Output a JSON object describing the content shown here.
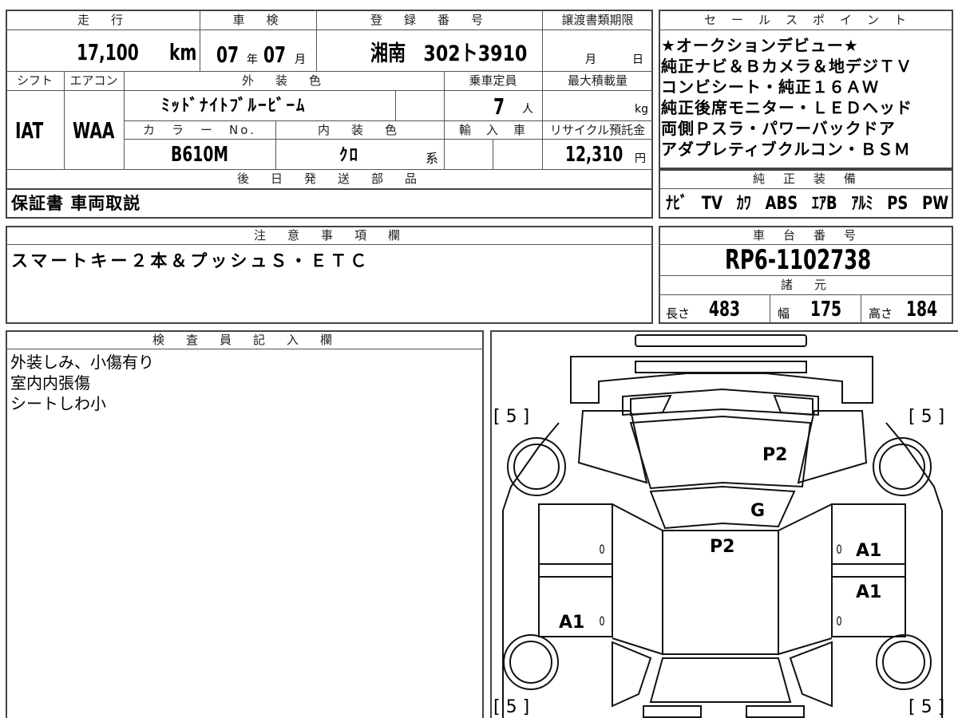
{
  "top_table": {
    "mileage_header": "走　行",
    "mileage_value": "17,100",
    "mileage_unit": "km",
    "inspection_header": "車　検",
    "inspection_year": "07",
    "inspection_year_unit": "年",
    "inspection_month": "07",
    "inspection_month_unit": "月",
    "registration_header": "登　録　番　号",
    "registration_value": "湘南　302ト3910",
    "transfer_header": "譲渡書類期限",
    "transfer_month_unit": "月",
    "transfer_day_unit": "日",
    "shift_header": "シフト",
    "shift_value": "IAT",
    "aircon_header": "エアコン",
    "aircon_value": "WAA",
    "exterior_header": "外　装　色",
    "exterior_value": "ﾐｯﾄﾞﾅｲﾄﾌﾞﾙｰﾋﾞｰﾑ",
    "capacity_header": "乗車定員",
    "capacity_value": "7",
    "capacity_unit": "人",
    "max_load_header": "最大積載量",
    "max_load_unit": "kg",
    "color_no_header": "カ　ラ　ー　No.",
    "color_no_value": "B610M",
    "interior_header": "内　装　色",
    "interior_value": "ｸﾛ",
    "interior_suffix": "系",
    "import_header": "輸　入　車",
    "recycle_header": "リサイクル預託金",
    "recycle_value": "12,310",
    "recycle_unit": "円",
    "parts_header": "後　日　発　送　部　品",
    "parts_value": "保証書 車両取説"
  },
  "sales_points": {
    "header": "セ　ー　ル　ス　ポ　イ　ン　ト",
    "lines": [
      "★オークションデビュー★",
      "純正ナビ＆Ｂカメラ＆地デジＴＶ",
      "コンビシート・純正１６ＡＷ",
      "純正後席モニター・ＬＥＤヘッド",
      "両側Ｐスラ・パワーバックドア",
      "アダプレティブクルコン・ＢＳＭ"
    ]
  },
  "equipment": {
    "header": "純　正　装　備",
    "items": [
      "ﾅﾋﾞ",
      "TV",
      "ｶﾜ",
      "ABS",
      "ｴｱB",
      "ｱﾙﾐ",
      "PS",
      "PW"
    ]
  },
  "notes": {
    "header": "注　意　事　項　欄",
    "value": "スマートキー２本＆プッシュＳ・ＥＴＣ"
  },
  "chassis": {
    "header": "車　台　番　号",
    "value": "RP6-1102738",
    "spec_header": "諸　元",
    "length_label": "長さ",
    "length_value": "483",
    "width_label": "幅",
    "width_value": "175",
    "height_label": "高さ",
    "height_value": "184"
  },
  "inspector": {
    "header": "検　査　員　記　入　欄",
    "lines": [
      "外装しみ、小傷有り",
      "室内内張傷",
      "シートしわ小"
    ]
  },
  "diagram": {
    "tire_depths": [
      "[ 5 ]",
      "[ 5 ]",
      "[ 5 ]",
      "[ 5 ]"
    ],
    "marks": {
      "hood": "P2",
      "windshield": "G",
      "roof": "P2",
      "right_front_door": "A1",
      "right_rear_door": "A1",
      "left_rear_door": "A1"
    },
    "zero": "0"
  }
}
